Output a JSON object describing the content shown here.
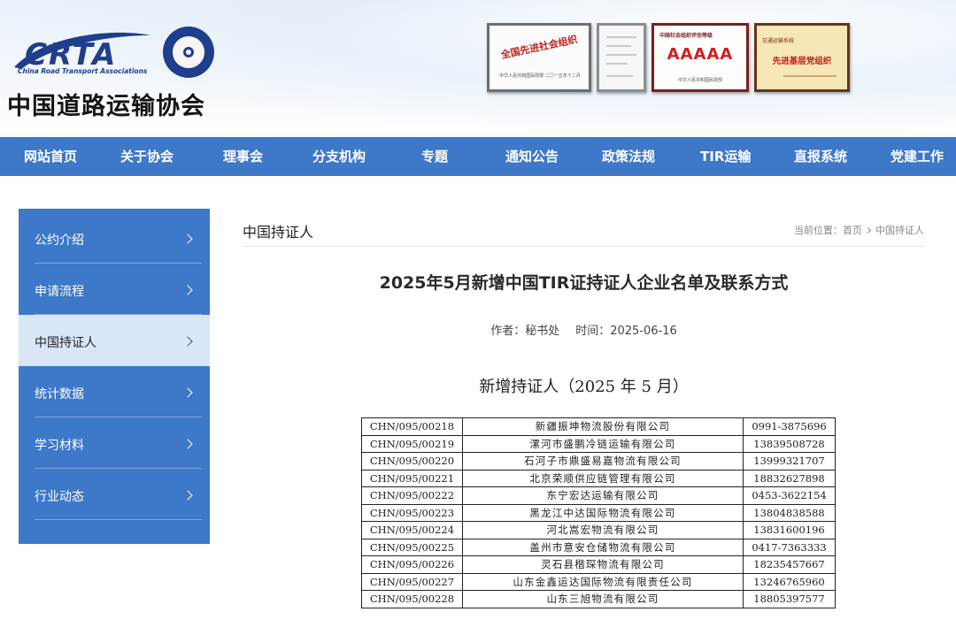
{
  "header": {
    "logo_text": "CRTA",
    "logo_subtitle": "China Road Transport Associations",
    "site_name": "中国道路运输协会",
    "plaques": [
      {
        "title": "全国先进社会组织",
        "footer": "中华人民共和国民政部 二〇一五年十二月"
      },
      {
        "title": "China Road Transport Association (CRTA)"
      },
      {
        "header": "中国社会组织评估等级",
        "title": "AAAAA",
        "footer": "中华人民共和国民政部"
      },
      {
        "header": "交通运输系统",
        "title": "先进基层党组织"
      }
    ]
  },
  "nav": {
    "items": [
      "网站首页",
      "关于协会",
      "理事会",
      "分支机构",
      "专题",
      "通知公告",
      "政策法规",
      "TIR运输",
      "直报系统",
      "党建工作"
    ]
  },
  "sidebar": {
    "items": [
      {
        "label": "公约介绍",
        "active": false
      },
      {
        "label": "申请流程",
        "active": false
      },
      {
        "label": "中国持证人",
        "active": true
      },
      {
        "label": "统计数据",
        "active": false
      },
      {
        "label": "学习材料",
        "active": false
      },
      {
        "label": "行业动态",
        "active": false
      }
    ]
  },
  "breadcrumb": {
    "section_title": "中国持证人",
    "prefix": "当前位置：",
    "home": "首页",
    "current": "中国持证人"
  },
  "article": {
    "title": "2025年5月新增中国TIR证持证人企业名单及联系方式",
    "author": "作者：秘书处",
    "time": "时间：2025-06-16",
    "subtitle": "新增持证人（2025 年 5 月）",
    "rows": [
      [
        "CHN/095/00218",
        "新疆振坤物流股份有限公司",
        "0991-3875696"
      ],
      [
        "CHN/095/00219",
        "漯河市盛鹏冷链运输有限公司",
        "13839508728"
      ],
      [
        "CHN/095/00220",
        "石河子市鼎盛易嘉物流有限公司",
        "13999321707"
      ],
      [
        "CHN/095/00221",
        "北京荣顺供应链管理有限公司",
        "18832627898"
      ],
      [
        "CHN/095/00222",
        "东宁宏达运输有限公司",
        "0453-3622154"
      ],
      [
        "CHN/095/00223",
        "黑龙江中达国际物流有限公司",
        "13804838588"
      ],
      [
        "CHN/095/00224",
        "河北嵩宏物流有限公司",
        "13831600196"
      ],
      [
        "CHN/095/00225",
        "盖州市意安仓储物流有限公司",
        "0417-7363333"
      ],
      [
        "CHN/095/00226",
        "灵石县楷琛物流有限公司",
        "18235457667"
      ],
      [
        "CHN/095/00227",
        "山东金鑫运达国际物流有限责任公司",
        "13246765960"
      ],
      [
        "CHN/095/00228",
        "山东三旭物流有限公司",
        "18805397577"
      ]
    ]
  },
  "colors": {
    "brand_blue": "#3e78c8",
    "active_item_bg": "#d9e6f8",
    "logo_blue": "#1f3e8c"
  }
}
